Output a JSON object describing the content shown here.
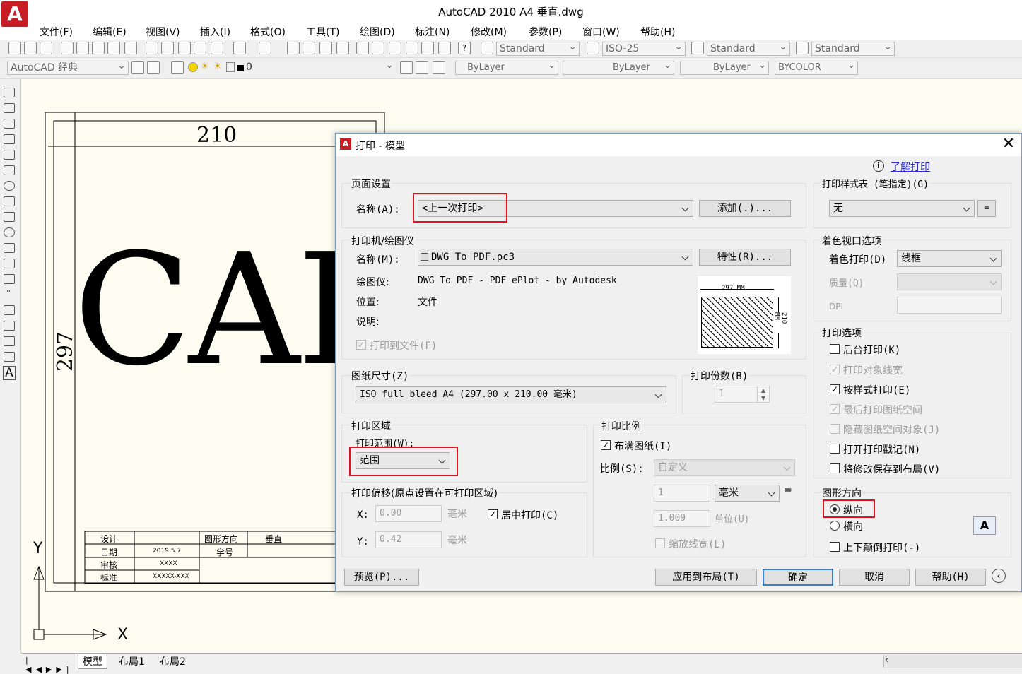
{
  "app": {
    "title": "AutoCAD 2010    A4 垂直.dwg",
    "logo": "A"
  },
  "menu": [
    "文件(F)",
    "编辑(E)",
    "视图(V)",
    "插入(I)",
    "格式(O)",
    "工具(T)",
    "绘图(D)",
    "标注(N)",
    "修改(M)",
    "参数(P)",
    "窗口(W)",
    "帮助(H)"
  ],
  "toolbar": {
    "text_style": "Standard",
    "dim_style": "ISO-25",
    "table_style": "Standard",
    "mleader_style": "Standard",
    "workspace": "AutoCAD 经典",
    "layer": "0",
    "color": "ByLayer",
    "linetype": "ByLayer",
    "lineweight": "ByLayer",
    "plotstyle": "BYCOLOR"
  },
  "drawing": {
    "dim_width": "210",
    "dim_height": "297",
    "big_text": "CAD",
    "axis_y": "Y",
    "axis_x": "X",
    "titleblock": {
      "design": "设计",
      "date": "日期",
      "date_val": "2019.5.7",
      "review": "审核",
      "review_val": "XXXX",
      "standard": "标准",
      "standard_val": "XXXXX-XXX",
      "orient": "图形方向",
      "orient_val": "垂直",
      "student_no": "学号"
    }
  },
  "tabs": [
    "模型",
    "布局1",
    "布局2"
  ],
  "dialog": {
    "title": "打印 - 模型",
    "help_link": "了解打印",
    "page_setup": {
      "group": "页面设置",
      "name_label": "名称(A):",
      "name_value": "<上一次打印>",
      "add_button": "添加(.)..."
    },
    "printer": {
      "group": "打印机/绘图仪",
      "name_label": "名称(M):",
      "name_value": "DWG To PDF.pc3",
      "props_button": "特性(R)...",
      "plotter_label": "绘图仪:",
      "plotter_value": "DWG To PDF - PDF ePlot - by Autodesk",
      "location_label": "位置:",
      "location_value": "文件",
      "desc_label": "说明:",
      "print_to_file": "打印到文件(F)",
      "preview_w": "297 MM",
      "preview_h": "210 MM"
    },
    "paper_size": {
      "group": "图纸尺寸(Z)",
      "value": "ISO full bleed A4 (297.00 x 210.00 毫米)"
    },
    "copies": {
      "group": "打印份数(B)",
      "value": "1"
    },
    "plot_area": {
      "group": "打印区域",
      "range_label": "打印范围(W):",
      "range_value": "范围"
    },
    "plot_offset": {
      "group": "打印偏移(原点设置在可打印区域)",
      "x_label": "X:",
      "x_value": "0.00",
      "x_unit": "毫米",
      "y_label": "Y:",
      "y_value": "0.42",
      "y_unit": "毫米",
      "center": "居中打印(C)"
    },
    "plot_scale": {
      "group": "打印比例",
      "fit": "布满图纸(I)",
      "scale_label": "比例(S):",
      "scale_value": "自定义",
      "v1": "1",
      "unit1": "毫米",
      "eq": "=",
      "v2": "1.009",
      "unit2": "单位(U)",
      "lineweights": "缩放线宽(L)"
    },
    "style_table": {
      "group": "打印样式表 (笔指定)(G)",
      "value": "无"
    },
    "shaded": {
      "group": "着色视口选项",
      "shade_label": "着色打印(D)",
      "shade_value": "线框",
      "quality_label": "质量(Q)",
      "dpi_label": "DPI"
    },
    "options": {
      "group": "打印选项",
      "items": [
        "后台打印(K)",
        "打印对象线宽",
        "按样式打印(E)",
        "最后打印图纸空间",
        "隐藏图纸空间对象(J)",
        "打开打印戳记(N)",
        "将修改保存到布局(V)"
      ]
    },
    "orientation": {
      "group": "图形方向",
      "portrait": "纵向",
      "landscape": "横向",
      "upside_down": "上下颠倒打印(-)"
    },
    "buttons": {
      "preview": "预览(P)...",
      "apply": "应用到布局(T)",
      "ok": "确定",
      "cancel": "取消",
      "help": "帮助(H)"
    }
  }
}
